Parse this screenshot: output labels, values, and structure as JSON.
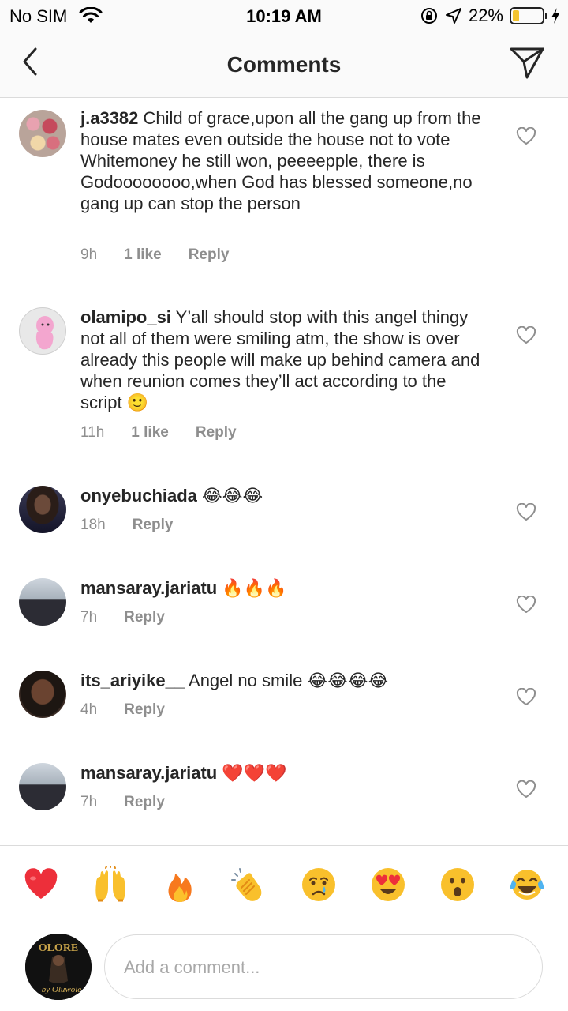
{
  "status": {
    "carrier": "No SIM",
    "time": "10:19 AM",
    "battery": "22%",
    "battery_level": 0.22
  },
  "nav": {
    "title": "Comments"
  },
  "comments": [
    {
      "user": "j.a3382",
      "text": "Child of grace,upon all the gang up from the house mates even outside the house not to vote Whitemoney he still won, peeeepple, there is Godoooooooo,when God has blessed someone,no gang up can stop the person",
      "time": "9h",
      "likes": "1 like",
      "reply": "Reply"
    },
    {
      "user": "olamipo_si",
      "text": "Y’all should stop with this angel thingy not all of them were smiling atm, the show is over already this people will make up behind camera and when reunion comes they’ll act according to the script",
      "emoji": "🙂",
      "time": "11h",
      "likes": "1 like",
      "reply": "Reply"
    },
    {
      "user": "onyebuchiada",
      "text": "",
      "emoji": "😂😂😂",
      "time": "18h",
      "reply": "Reply"
    },
    {
      "user": "mansaray.jariatu",
      "text": "",
      "emoji": "🔥🔥🔥",
      "time": "7h",
      "reply": "Reply"
    },
    {
      "user": "its_ariyike__",
      "text": "Angel no smile",
      "emoji": "😂😂😂😂",
      "time": "4h",
      "reply": "Reply"
    },
    {
      "user": "mansaray.jariatu",
      "text": "",
      "emoji": "❤️❤️❤️",
      "time": "7h",
      "reply": "Reply"
    }
  ],
  "reactions": [
    {
      "name": "red-heart",
      "glyph": "❤️"
    },
    {
      "name": "raising-hands",
      "glyph": "🙌"
    },
    {
      "name": "fire",
      "glyph": "🔥"
    },
    {
      "name": "clapping-hands",
      "glyph": "👏"
    },
    {
      "name": "crying-face",
      "glyph": "😢"
    },
    {
      "name": "heart-eyes",
      "glyph": "😍"
    },
    {
      "name": "astonished-face",
      "glyph": "😮"
    },
    {
      "name": "tears-of-joy",
      "glyph": "😂"
    }
  ],
  "composer": {
    "placeholder": "Add a comment...",
    "avatar_text": "OLORE",
    "avatar_script": "by Oluwole"
  },
  "colors": {
    "heart_red": "#ed2f3a",
    "flame_orange": "#f7791e",
    "emoji_yellow": "#f9c02c",
    "muted_text": "#8e8e8e"
  }
}
